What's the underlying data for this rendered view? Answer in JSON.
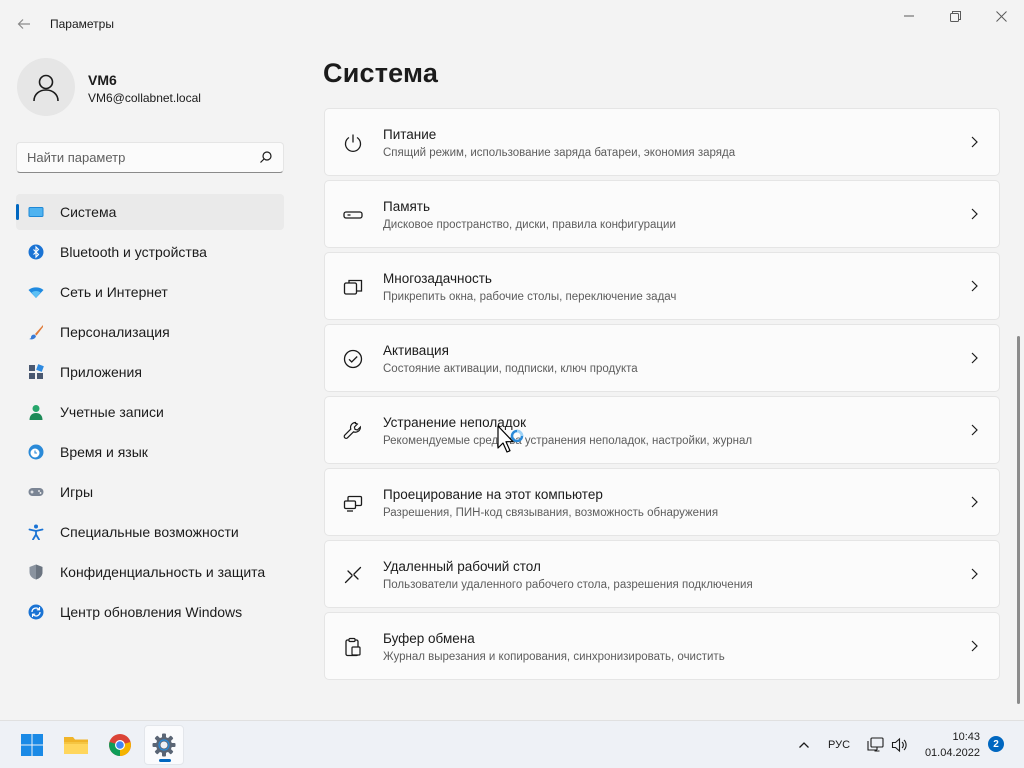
{
  "window": {
    "title": "Параметры"
  },
  "profile": {
    "name": "VM6",
    "email": "VM6@collabnet.local"
  },
  "search": {
    "placeholder": "Найти параметр"
  },
  "sidebar": {
    "items": [
      {
        "label": "Система",
        "icon": "monitor-icon",
        "active": true
      },
      {
        "label": "Bluetooth и устройства",
        "icon": "bluetooth-icon"
      },
      {
        "label": "Сеть и Интернет",
        "icon": "wifi-icon"
      },
      {
        "label": "Персонализация",
        "icon": "brush-icon"
      },
      {
        "label": "Приложения",
        "icon": "apps-icon"
      },
      {
        "label": "Учетные записи",
        "icon": "account-icon"
      },
      {
        "label": "Время и язык",
        "icon": "clock-globe-icon"
      },
      {
        "label": "Игры",
        "icon": "gamepad-icon"
      },
      {
        "label": "Специальные возможности",
        "icon": "accessibility-icon"
      },
      {
        "label": "Конфиденциальность и защита",
        "icon": "shield-icon"
      },
      {
        "label": "Центр обновления Windows",
        "icon": "update-icon"
      }
    ]
  },
  "main": {
    "title": "Система",
    "cards": [
      {
        "title": "Питание",
        "desc": "Спящий режим, использование заряда батареи, экономия заряда",
        "icon": "power-icon"
      },
      {
        "title": "Память",
        "desc": "Дисковое пространство, диски, правила конфигурации",
        "icon": "storage-icon"
      },
      {
        "title": "Многозадачность",
        "desc": "Прикрепить окна, рабочие столы, переключение задач",
        "icon": "multitasking-icon"
      },
      {
        "title": "Активация",
        "desc": "Состояние активации, подписки, ключ продукта",
        "icon": "activation-check-icon"
      },
      {
        "title": "Устранение неполадок",
        "desc": "Рекомендуемые средства устранения неполадок, настройки, журнал",
        "icon": "wrench-icon"
      },
      {
        "title": "Проецирование на этот компьютер",
        "desc": "Разрешения, ПИН-код связывания, возможность обнаружения",
        "icon": "projection-icon"
      },
      {
        "title": "Удаленный рабочий стол",
        "desc": "Пользователи удаленного рабочего стола, разрешения подключения",
        "icon": "remote-desktop-icon"
      },
      {
        "title": "Буфер обмена",
        "desc": "Журнал вырезания и копирования, синхронизировать, очистить",
        "icon": "clipboard-icon"
      }
    ]
  },
  "taskbar": {
    "apps": [
      "start-icon",
      "file-explorer-icon",
      "chrome-icon",
      "settings-gear-icon"
    ],
    "language": "РУС",
    "time": "10:43",
    "date": "01.04.2022",
    "notification_count": "2"
  },
  "colors": {
    "accent": "#0067c0",
    "background": "#f3f3f3",
    "card": "#fbfbfb"
  }
}
